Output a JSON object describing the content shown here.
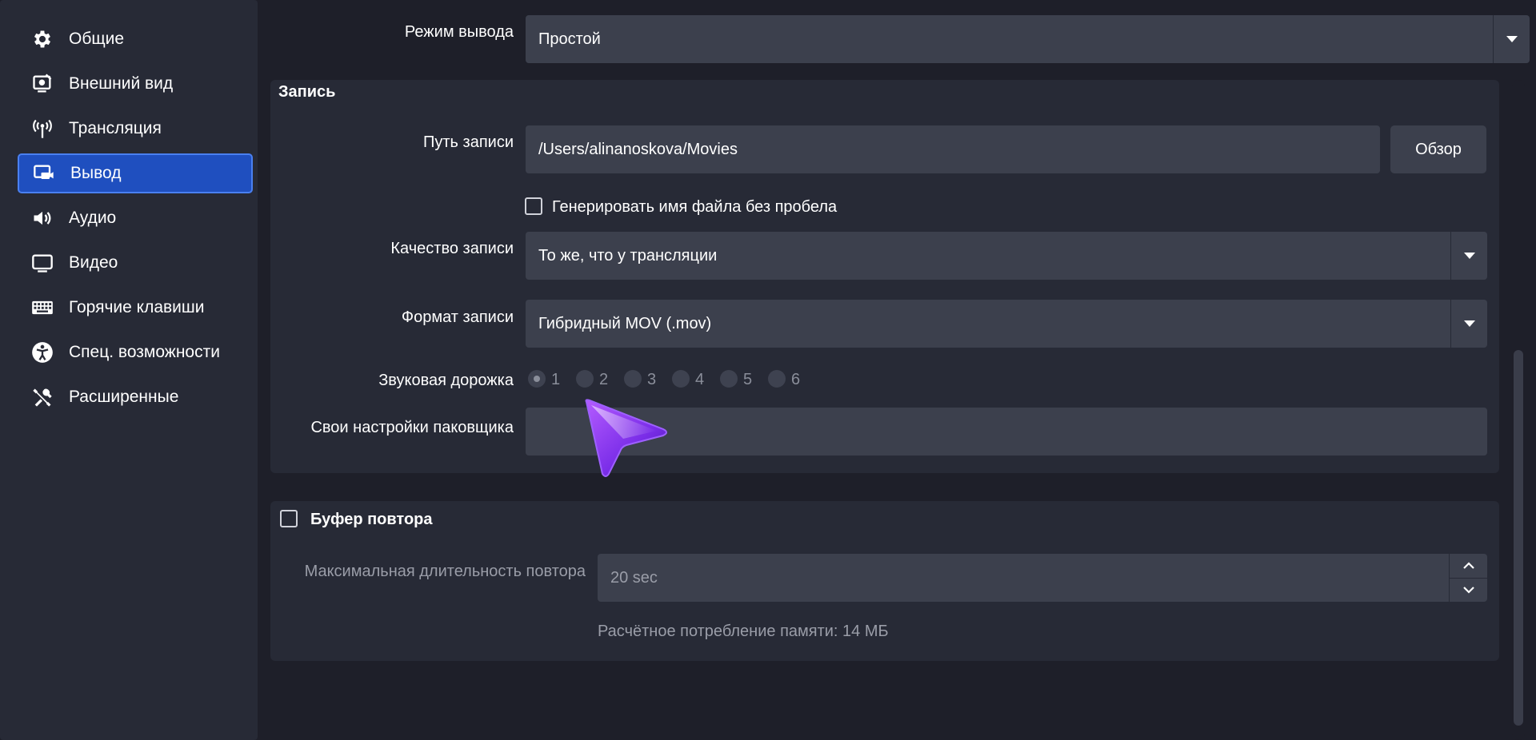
{
  "sidebar": {
    "items": [
      {
        "label": "Общие",
        "icon": "gear-icon"
      },
      {
        "label": "Внешний вид",
        "icon": "appearance-icon"
      },
      {
        "label": "Трансляция",
        "icon": "antenna-icon"
      },
      {
        "label": "Вывод",
        "icon": "output-icon",
        "active": true
      },
      {
        "label": "Аудио",
        "icon": "speaker-icon"
      },
      {
        "label": "Видео",
        "icon": "monitor-icon"
      },
      {
        "label": "Горячие клавиши",
        "icon": "keyboard-icon"
      },
      {
        "label": "Спец. возможности",
        "icon": "accessibility-icon"
      },
      {
        "label": "Расширенные",
        "icon": "tools-icon"
      }
    ]
  },
  "output_mode": {
    "label": "Режим вывода",
    "value": "Простой"
  },
  "recording": {
    "title": "Запись",
    "path_label": "Путь записи",
    "path_value": "/Users/alinanoskova/Movies",
    "browse_button": "Обзор",
    "no_space_checkbox": "Генерировать имя файла без пробела",
    "no_space_checked": false,
    "quality_label": "Качество записи",
    "quality_value": "То же, что у трансляции",
    "format_label": "Формат записи",
    "format_value": "Гибридный MOV (.mov)",
    "audio_track_label": "Звуковая дорожка",
    "audio_tracks": [
      "1",
      "2",
      "3",
      "4",
      "5",
      "6"
    ],
    "audio_track_selected": "1",
    "muxer_label": "Свои настройки паковщика",
    "muxer_value": ""
  },
  "replay_buffer": {
    "title": "Буфер повтора",
    "enabled": false,
    "max_duration_label": "Максимальная длительность повтора",
    "max_duration_value": "20 sec",
    "memory_estimate": "Расчётное потребление памяти: 14 МБ"
  },
  "colors": {
    "background": "#1e1f29",
    "panel": "#272a36",
    "field": "#3c404d",
    "accent": "#1f4fbf",
    "cursor": "#8b3cf0"
  }
}
